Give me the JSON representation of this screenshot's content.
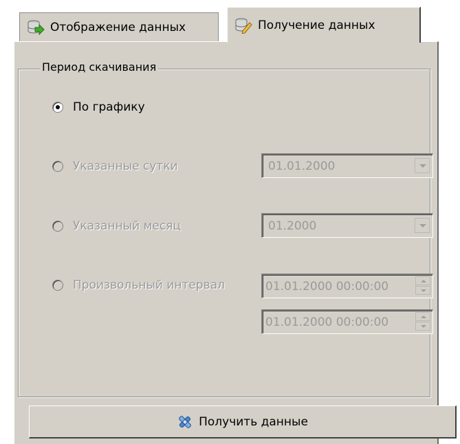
{
  "tabs": [
    {
      "label": "Отображение данных",
      "icon": "database-arrow-icon",
      "active": false
    },
    {
      "label": "Получение данных",
      "icon": "database-edit-icon",
      "active": true
    }
  ],
  "period": {
    "title": "Период скачивания",
    "options": [
      {
        "label": "По графику",
        "checked": true,
        "enabled": true
      },
      {
        "label": "Указанные сутки",
        "checked": false,
        "enabled": false,
        "value": "01.01.2000"
      },
      {
        "label": "Указанный месяц",
        "checked": false,
        "enabled": false,
        "value": "01.2000"
      },
      {
        "label": "Произвольный интервал",
        "checked": false,
        "enabled": false,
        "from": "01.01.2000 00:00:00",
        "to": "01.01.2000 00:00:00"
      }
    ]
  },
  "action": {
    "label": "Получить данные",
    "icon": "satellite-icon"
  },
  "colors": {
    "panel": "#d4d0c8",
    "disabled_text": "#9a9a9a"
  }
}
